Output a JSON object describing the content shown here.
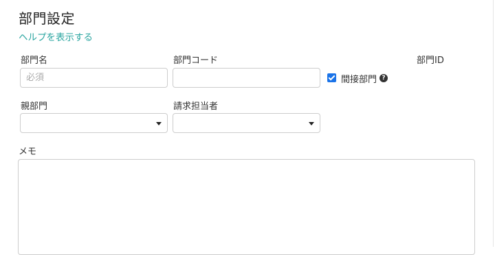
{
  "page": {
    "title": "部門設定",
    "help_link": "ヘルプを表示する"
  },
  "form": {
    "department_name_label": "部門名",
    "department_name_placeholder": "必須",
    "department_name_value": "",
    "department_code_label": "部門コード",
    "department_code_value": "",
    "indirect_department_label": "間接部門",
    "indirect_department_checked": true,
    "department_id_label": "部門ID",
    "parent_department_label": "親部門",
    "parent_department_value": "",
    "billing_person_label": "請求担当者",
    "billing_person_value": "",
    "memo_label": "メモ",
    "memo_value": ""
  },
  "icons": {
    "help": "question-circle-icon",
    "dropdown": "caret-down-icon",
    "checkbox": "checkbox-checked-icon"
  },
  "colors": {
    "link": "#2aa5a0",
    "checkbox": "#1a73e8",
    "border": "#cccccc"
  }
}
